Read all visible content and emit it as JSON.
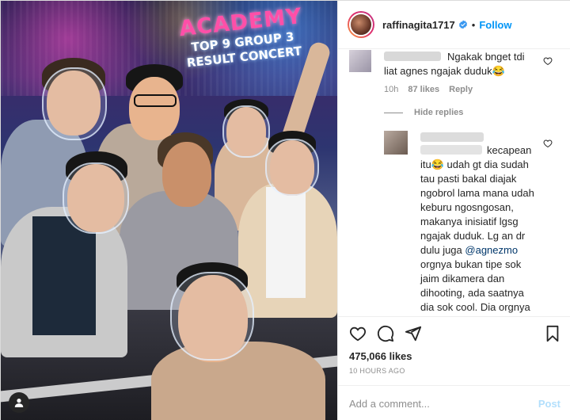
{
  "photo": {
    "sign": {
      "line1": "ACADEMY",
      "line2": "TOP 9 GROUP 3",
      "line3": "RESULT CONCERT"
    }
  },
  "header": {
    "username": "raffinagita1717",
    "separator": "•",
    "follow_label": "Follow"
  },
  "comments": [
    {
      "text": "Ngakak bnget tdi liat agnes ngajak duduk😂",
      "time": "10h",
      "likes": "87 likes",
      "reply_label": "Reply"
    }
  ],
  "hide_replies_label": "Hide replies",
  "reply": {
    "text_before_mention": "kecapean itu😂 udah gt dia sudah tau pasti bakal diajak ngobrol lama mana udah keburu ngosngosan, makanya inisiatif lgsg ngajak duduk. Lg an dr dulu juga ",
    "mention": "@agnezmo",
    "text_after_mention": " orgnya bukan tipe sok jaim dikamera dan dihooting, ada saatnya dia sok cool. Dia orgnya bisa ngelawak sejak kecil. 😂"
  },
  "likes_count": "475,066 likes",
  "posted_time": "10 HOURS AGO",
  "add_comment": {
    "placeholder": "Add a comment...",
    "post_label": "Post"
  },
  "colors": {
    "link_blue": "#0095f6",
    "post_disabled": "#b2dffc",
    "muted": "#8e8e8e",
    "mention": "#00376b"
  }
}
